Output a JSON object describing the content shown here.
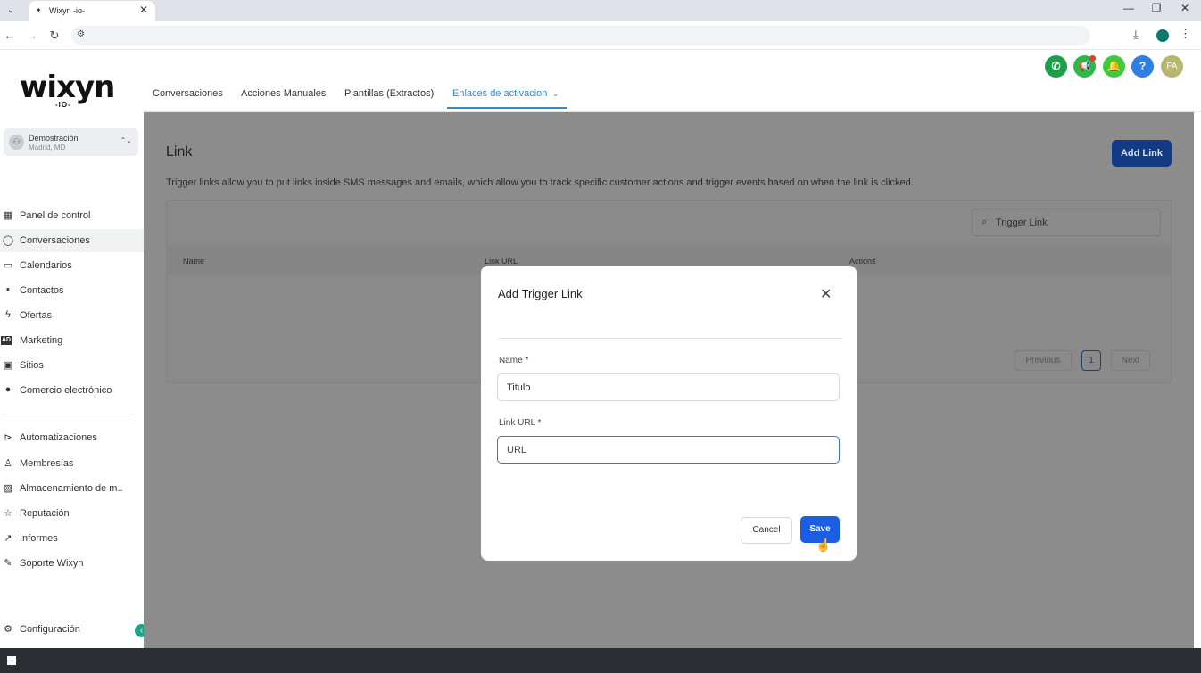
{
  "browser": {
    "tab_title": "Wixyn -io-",
    "tab_close": "✕",
    "tab_menu": "⌄",
    "win_minimize": "—",
    "win_restore": "❐",
    "win_close": "✕"
  },
  "brand": {
    "logo": "wixyn",
    "logo_sub": "-IO-"
  },
  "account": {
    "name": "Demostración",
    "location": "Madrid, MD"
  },
  "sidebar": {
    "items": [
      {
        "label": "Panel de control",
        "icon": "dashboard-icon"
      },
      {
        "label": "Conversaciones",
        "icon": "chat-icon",
        "active": true
      },
      {
        "label": "Calendarios",
        "icon": "calendar-icon"
      },
      {
        "label": "Contactos",
        "icon": "contacts-icon"
      },
      {
        "label": "Ofertas",
        "icon": "bolt-icon"
      },
      {
        "label": "Marketing",
        "icon": "ad-icon"
      },
      {
        "label": "Sitios",
        "icon": "sites-icon"
      },
      {
        "label": "Comercio electrónico",
        "icon": "ecommerce-icon"
      },
      {
        "label": "Automatizaciones",
        "icon": "automation-icon"
      },
      {
        "label": "Membresías",
        "icon": "membership-icon"
      },
      {
        "label": "Almacenamiento de m..",
        "icon": "media-storage-icon"
      },
      {
        "label": "Reputación",
        "icon": "star-icon"
      },
      {
        "label": "Informes",
        "icon": "reports-icon"
      },
      {
        "label": "Soporte Wixyn",
        "icon": "wrench-icon"
      }
    ],
    "settings_label": "Configuración"
  },
  "topnav": {
    "tabs": [
      {
        "label": "Conversaciones"
      },
      {
        "label": "Acciones Manuales"
      },
      {
        "label": "Plantillas (Extractos)"
      },
      {
        "label": "Enlaces de activacion",
        "active": true
      }
    ],
    "avatar_initials": "FA",
    "colors": {
      "phone": "#1e9e4a",
      "megaphone": "#2fb84a",
      "bell": "#41c93b",
      "help": "#2d7fe0",
      "avatar": "#b6b66e"
    }
  },
  "page": {
    "title": "Link",
    "description": "Trigger links allow you to put links inside SMS messages and emails, which allow you to track specific customer actions and trigger events based on when the link is clicked.",
    "add_button": "Add Link",
    "search_placeholder": "Trigger Link",
    "columns": [
      "Name",
      "Link URL",
      "Actions"
    ],
    "pagination": {
      "previous": "Previous",
      "current": "1",
      "next": "Next"
    }
  },
  "modal": {
    "title": "Add Trigger Link",
    "name_label": "Name *",
    "name_value": "Titulo",
    "url_label": "Link URL *",
    "url_value": "URL",
    "cancel": "Cancel",
    "save": "Save"
  }
}
